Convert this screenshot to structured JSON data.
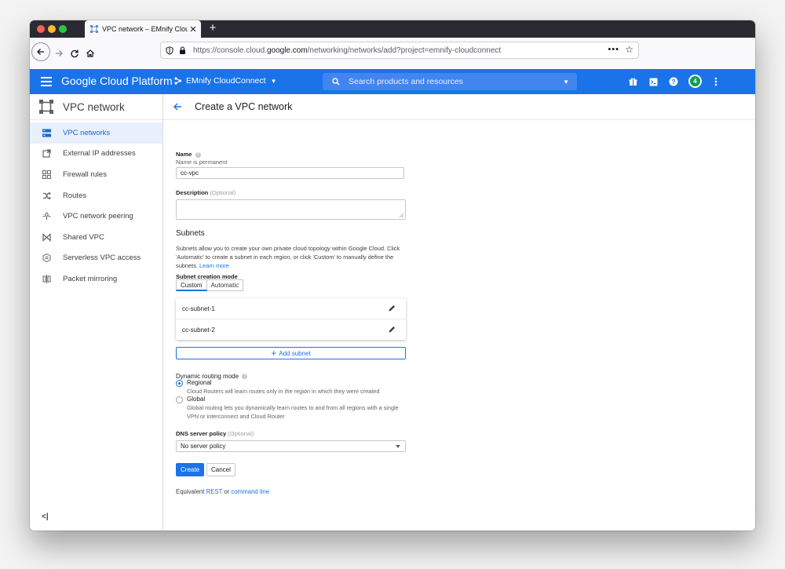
{
  "browser": {
    "tab_title": "VPC network – EMnify CloudCo",
    "url_prefix": "https://console.cloud.",
    "url_domain": "google.com",
    "url_path": "/networking/networks/add?project=emnify-cloudconnect",
    "new_tab": "+",
    "menu": "•••"
  },
  "header": {
    "product": "Google Cloud Platform",
    "project": "EMnify CloudConnect",
    "search_placeholder": "Search products and resources",
    "notification_count": "4"
  },
  "sidebar": {
    "title": "VPC network",
    "items": [
      {
        "label": "VPC networks",
        "icon": "vpc-networks-icon"
      },
      {
        "label": "External IP addresses",
        "icon": "external-ip-icon"
      },
      {
        "label": "Firewall rules",
        "icon": "firewall-icon"
      },
      {
        "label": "Routes",
        "icon": "routes-icon"
      },
      {
        "label": "VPC network peering",
        "icon": "peering-icon"
      },
      {
        "label": "Shared VPC",
        "icon": "shared-vpc-icon"
      },
      {
        "label": "Serverless VPC access",
        "icon": "serverless-icon"
      },
      {
        "label": "Packet mirroring",
        "icon": "packet-mirroring-icon"
      }
    ],
    "collapse": "<|"
  },
  "page": {
    "title": "Create a VPC network",
    "name_label": "Name",
    "name_hint": "Name is permanent",
    "name_value": "cc-vpc",
    "description_label": "Description",
    "optional": "(Optional)",
    "subnets_title": "Subnets",
    "subnets_text": "Subnets allow you to create your own private cloud topology within Google Cloud. Click 'Automatic' to create a subnet in each region, or click 'Custom' to manually define the subnets.",
    "learn_more": "Learn more",
    "subnet_mode_label": "Subnet creation mode",
    "mode_custom": "Custom",
    "mode_automatic": "Automatic",
    "subnets": [
      "cc-subnet-1",
      "cc-subnet-2"
    ],
    "add_subnet": "Add subnet",
    "routing_label": "Dynamic routing mode",
    "routing_regional": "Regional",
    "routing_regional_desc": "Cloud Routers will learn routes only in the region in which they were created",
    "routing_global": "Global",
    "routing_global_desc": "Global routing lets you dynamically learn routes to and from all regions with a single VPN or interconnect and Cloud Router",
    "dns_label": "DNS server policy",
    "dns_value": "No server policy",
    "create_button": "Create",
    "cancel_button": "Cancel",
    "equivalent": "Equivalent",
    "rest": "REST",
    "or": "or",
    "command_line": "command line"
  }
}
